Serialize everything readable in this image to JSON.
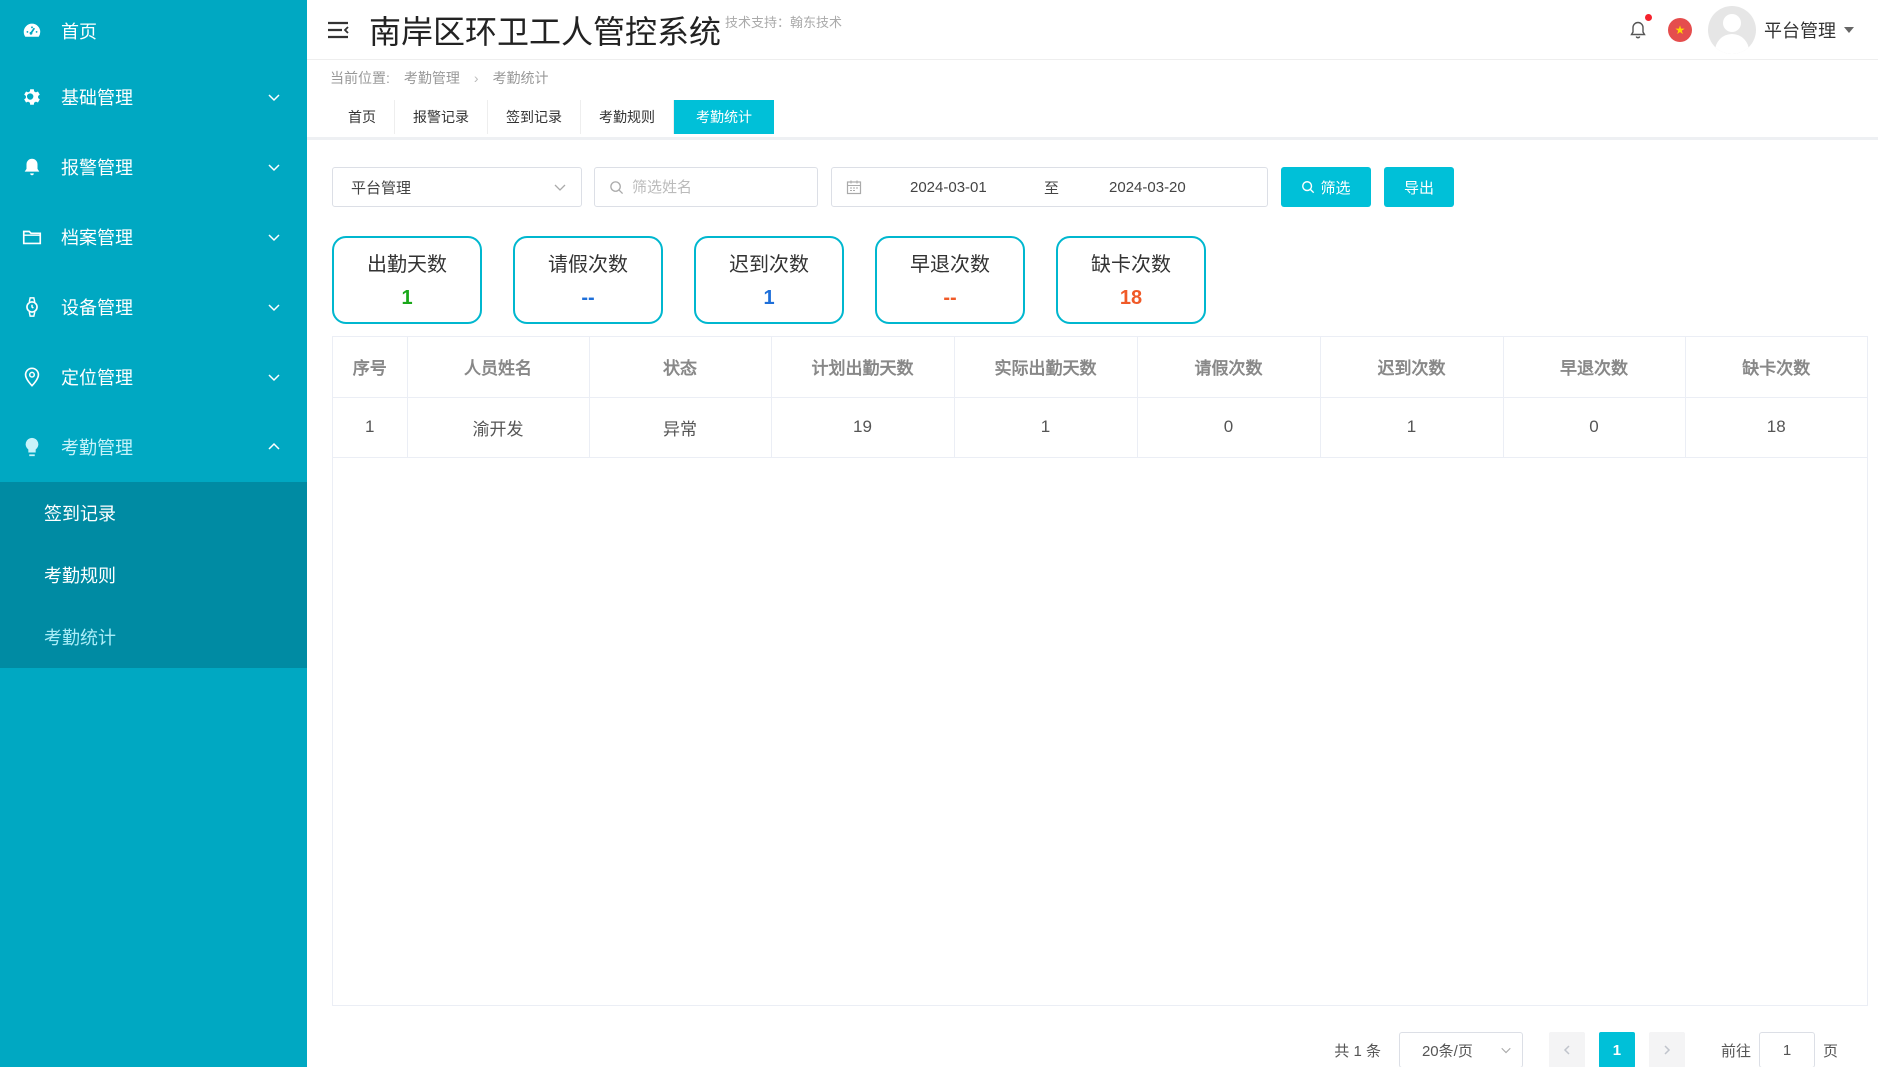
{
  "sidebar": {
    "items": [
      {
        "label": "首页",
        "icon": "dashboard-icon"
      },
      {
        "label": "基础管理",
        "icon": "gear-icon"
      },
      {
        "label": "报警管理",
        "icon": "bell-icon"
      },
      {
        "label": "档案管理",
        "icon": "folder-icon"
      },
      {
        "label": "设备管理",
        "icon": "watch-icon"
      },
      {
        "label": "定位管理",
        "icon": "location-icon"
      },
      {
        "label": "考勤管理",
        "icon": "lightbulb-icon"
      }
    ],
    "submenu": [
      "签到记录",
      "考勤规则",
      "考勤统计"
    ],
    "active_sub": "考勤统计",
    "bg_color": "#00a8c2"
  },
  "header": {
    "title": "南岸区环卫工人管控系统",
    "support": "技术支持：翰东技术",
    "user_name": "平台管理"
  },
  "breadcrumb": {
    "label": "当前位置:",
    "items": [
      "考勤管理",
      "考勤统计"
    ]
  },
  "tabs": [
    "首页",
    "报警记录",
    "签到记录",
    "考勤规则",
    "考勤统计"
  ],
  "filters": {
    "org_select": "平台管理",
    "name_placeholder": "筛选姓名",
    "start_date": "2024-03-01",
    "to_label": "至",
    "end_date": "2024-03-20",
    "filter_button": "筛选",
    "export_button": "导出"
  },
  "stats": [
    {
      "label": "出勤天数",
      "value": "1",
      "color": "#1aa81a"
    },
    {
      "label": "请假次数",
      "value": "--",
      "color": "#1e6fd9"
    },
    {
      "label": "迟到次数",
      "value": "1",
      "color": "#1e6fd9"
    },
    {
      "label": "早退次数",
      "value": "--",
      "color": "#f05a28"
    },
    {
      "label": "缺卡次数",
      "value": "18",
      "color": "#f05a28"
    }
  ],
  "table": {
    "columns": [
      "序号",
      "人员姓名",
      "状态",
      "计划出勤天数",
      "实际出勤天数",
      "请假次数",
      "迟到次数",
      "早退次数",
      "缺卡次数"
    ],
    "rows": [
      [
        "1",
        "渝开发",
        "异常",
        "19",
        "1",
        "0",
        "1",
        "0",
        "18"
      ]
    ]
  },
  "pagination": {
    "total": "共 1 条",
    "page_size": "20条/页",
    "current_page": "1",
    "goto_label": "前往",
    "goto_value": "1",
    "page_suffix": "页"
  },
  "accent_color": "#00c0d8"
}
